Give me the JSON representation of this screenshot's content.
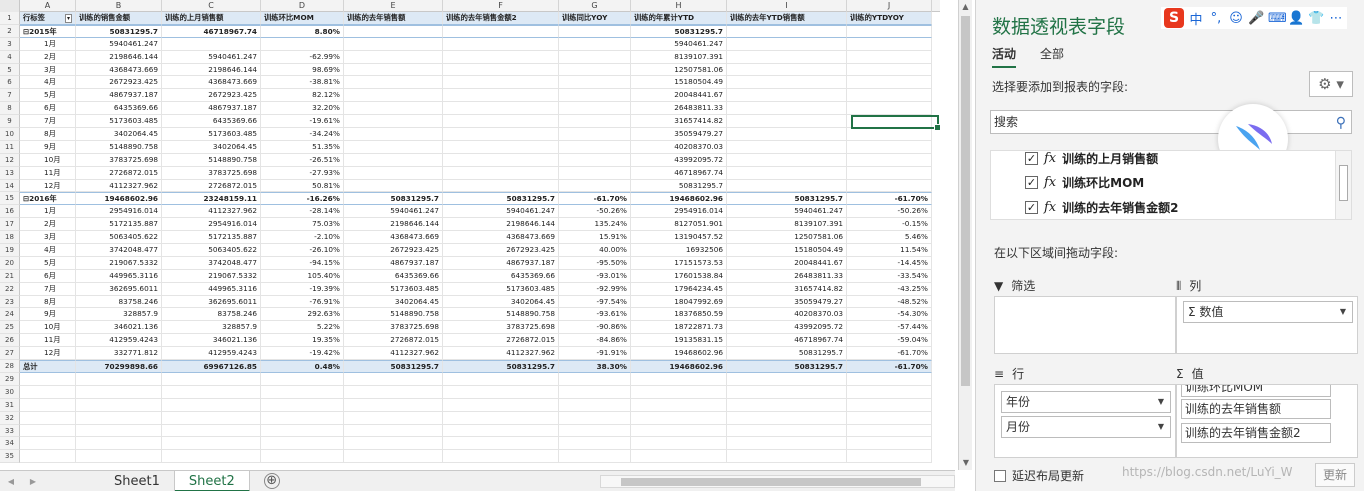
{
  "sheet": {
    "columns": [
      "A",
      "B",
      "C",
      "D",
      "E",
      "F",
      "G",
      "H",
      "I",
      "J"
    ],
    "headers": [
      "行标签",
      "训练的销售金额",
      "训练的上月销售额",
      "训练环比MOM",
      "训练的去年销售额",
      "训练的去年销售金额2",
      "训练同比YOY",
      "训练的年累计YTD",
      "训练的去年YTD销售额",
      "训练的YTDYOY"
    ],
    "rows": [
      [
        "2015年",
        "50831295.7",
        "46718967.74",
        "8.80%",
        "",
        "",
        "",
        "50831295.7",
        "",
        ""
      ],
      [
        "1月",
        "5940461.247",
        "",
        "",
        "",
        "",
        "",
        "5940461.247",
        "",
        ""
      ],
      [
        "2月",
        "2198646.144",
        "5940461.247",
        "-62.99%",
        "",
        "",
        "",
        "8139107.391",
        "",
        ""
      ],
      [
        "3月",
        "4368473.669",
        "2198646.144",
        "98.69%",
        "",
        "",
        "",
        "12507581.06",
        "",
        ""
      ],
      [
        "4月",
        "2672923.425",
        "4368473.669",
        "-38.81%",
        "",
        "",
        "",
        "15180504.49",
        "",
        ""
      ],
      [
        "5月",
        "4867937.187",
        "2672923.425",
        "82.12%",
        "",
        "",
        "",
        "20048441.67",
        "",
        ""
      ],
      [
        "6月",
        "6435369.66",
        "4867937.187",
        "32.20%",
        "",
        "",
        "",
        "26483811.33",
        "",
        ""
      ],
      [
        "7月",
        "5173603.485",
        "6435369.66",
        "-19.61%",
        "",
        "",
        "",
        "31657414.82",
        "",
        ""
      ],
      [
        "8月",
        "3402064.45",
        "5173603.485",
        "-34.24%",
        "",
        "",
        "",
        "35059479.27",
        "",
        ""
      ],
      [
        "9月",
        "5148890.758",
        "3402064.45",
        "51.35%",
        "",
        "",
        "",
        "40208370.03",
        "",
        ""
      ],
      [
        "10月",
        "3783725.698",
        "5148890.758",
        "-26.51%",
        "",
        "",
        "",
        "43992095.72",
        "",
        ""
      ],
      [
        "11月",
        "2726872.015",
        "3783725.698",
        "-27.93%",
        "",
        "",
        "",
        "46718967.74",
        "",
        ""
      ],
      [
        "12月",
        "4112327.962",
        "2726872.015",
        "50.81%",
        "",
        "",
        "",
        "50831295.7",
        "",
        ""
      ],
      [
        "2016年",
        "19468602.96",
        "23248159.11",
        "-16.26%",
        "50831295.7",
        "50831295.7",
        "-61.70%",
        "19468602.96",
        "50831295.7",
        "-61.70%"
      ],
      [
        "1月",
        "2954916.014",
        "4112327.962",
        "-28.14%",
        "5940461.247",
        "5940461.247",
        "-50.26%",
        "2954916.014",
        "5940461.247",
        "-50.26%"
      ],
      [
        "2月",
        "5172135.887",
        "2954916.014",
        "75.03%",
        "2198646.144",
        "2198646.144",
        "135.24%",
        "8127051.901",
        "8139107.391",
        "-0.15%"
      ],
      [
        "3月",
        "5063405.622",
        "5172135.887",
        "-2.10%",
        "4368473.669",
        "4368473.669",
        "15.91%",
        "13190457.52",
        "12507581.06",
        "5.46%"
      ],
      [
        "4月",
        "3742048.477",
        "5063405.622",
        "-26.10%",
        "2672923.425",
        "2672923.425",
        "40.00%",
        "16932506",
        "15180504.49",
        "11.54%"
      ],
      [
        "5月",
        "219067.5332",
        "3742048.477",
        "-94.15%",
        "4867937.187",
        "4867937.187",
        "-95.50%",
        "17151573.53",
        "20048441.67",
        "-14.45%"
      ],
      [
        "6月",
        "449965.3116",
        "219067.5332",
        "105.40%",
        "6435369.66",
        "6435369.66",
        "-93.01%",
        "17601538.84",
        "26483811.33",
        "-33.54%"
      ],
      [
        "7月",
        "362695.6011",
        "449965.3116",
        "-19.39%",
        "5173603.485",
        "5173603.485",
        "-92.99%",
        "17964234.45",
        "31657414.82",
        "-43.25%"
      ],
      [
        "8月",
        "83758.246",
        "362695.6011",
        "-76.91%",
        "3402064.45",
        "3402064.45",
        "-97.54%",
        "18047992.69",
        "35059479.27",
        "-48.52%"
      ],
      [
        "9月",
        "328857.9",
        "83758.246",
        "292.63%",
        "5148890.758",
        "5148890.758",
        "-93.61%",
        "18376850.59",
        "40208370.03",
        "-54.30%"
      ],
      [
        "10月",
        "346021.136",
        "328857.9",
        "5.22%",
        "3783725.698",
        "3783725.698",
        "-90.86%",
        "18722871.73",
        "43992095.72",
        "-57.44%"
      ],
      [
        "11月",
        "412959.4243",
        "346021.136",
        "19.35%",
        "2726872.015",
        "2726872.015",
        "-84.86%",
        "19135831.15",
        "46718967.74",
        "-59.04%"
      ],
      [
        "12月",
        "332771.812",
        "412959.4243",
        "-19.42%",
        "4112327.962",
        "4112327.962",
        "-91.91%",
        "19468602.96",
        "50831295.7",
        "-61.70%"
      ],
      [
        "总计",
        "70299898.66",
        "69967126.85",
        "0.48%",
        "50831295.7",
        "50831295.7",
        "38.30%",
        "19468602.96",
        "50831295.7",
        "-61.70%"
      ]
    ],
    "tabs": [
      "Sheet1",
      "Sheet2"
    ],
    "active_tab": "Sheet2",
    "add_sheet": "⊕"
  },
  "pane": {
    "title": "数据透视表字段",
    "tab_active": "活动",
    "tab_all": "全部",
    "add_label": "选择要添加到报表的字段:",
    "search_placeholder": "搜索",
    "fields": [
      "训练的上月销售额",
      "训练环比MOM",
      "训练的去年销售金额2"
    ],
    "drag_label": "在以下区域间拖动字段:",
    "filter": "筛选",
    "columns": "列",
    "columns_value": "数值",
    "rows": "行",
    "rows_items": [
      "年份",
      "月份"
    ],
    "values": "值",
    "values_items": [
      "训练环比MOM",
      "训练的去年销售额",
      "训练的去年销售金额2"
    ],
    "delay": "延迟布局更新",
    "update": "更新",
    "watermark": "https://blog.csdn.net/LuYi_W"
  },
  "ime": {
    "logo": "S",
    "items": [
      "中",
      "°,",
      "☺",
      "🎤",
      "⌨",
      "👤",
      "👕",
      "⋯"
    ]
  },
  "colors": {
    "accent": "#217346",
    "header_fill": "#dde9f5"
  }
}
